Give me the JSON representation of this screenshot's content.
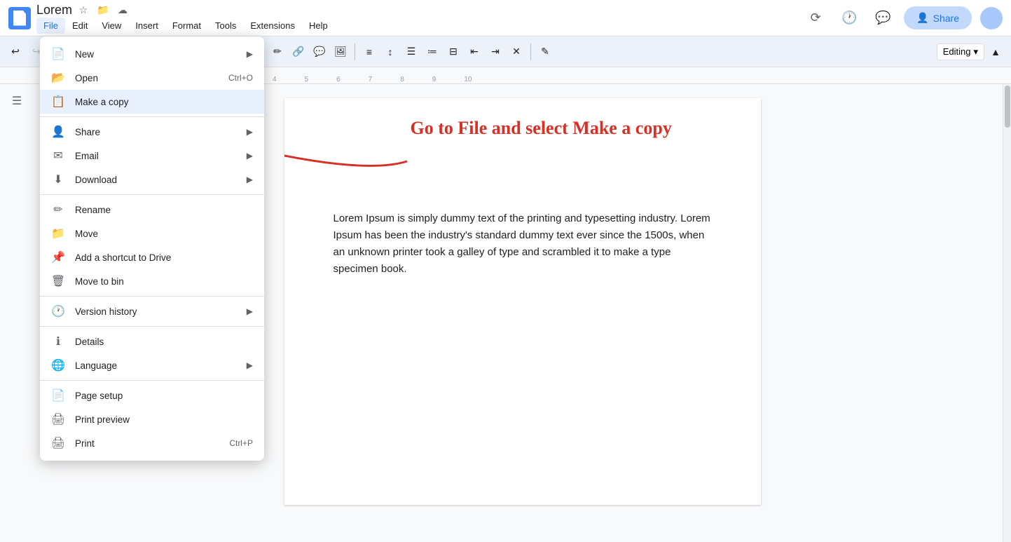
{
  "app": {
    "title": "Lorem",
    "icon_color": "#4285f4"
  },
  "header": {
    "doc_title": "Lorem",
    "share_label": "Share",
    "menu_items": [
      "File",
      "Edit",
      "View",
      "Insert",
      "Format",
      "Tools",
      "Extensions",
      "Help"
    ]
  },
  "toolbar": {
    "font": "Arial",
    "font_size": "14",
    "editing_label": "Editing"
  },
  "file_menu": {
    "items": [
      {
        "id": "new",
        "label": "New",
        "icon": "📄",
        "shortcut": "",
        "has_arrow": true,
        "section": 1
      },
      {
        "id": "open",
        "label": "Open",
        "icon": "📂",
        "shortcut": "Ctrl+O",
        "has_arrow": false,
        "section": 1
      },
      {
        "id": "make-copy",
        "label": "Make a copy",
        "icon": "📋",
        "shortcut": "",
        "has_arrow": false,
        "section": 1,
        "highlighted": true
      },
      {
        "id": "share",
        "label": "Share",
        "icon": "👤",
        "shortcut": "",
        "has_arrow": true,
        "section": 2
      },
      {
        "id": "email",
        "label": "Email",
        "icon": "✉️",
        "shortcut": "",
        "has_arrow": true,
        "section": 2
      },
      {
        "id": "download",
        "label": "Download",
        "icon": "⬇️",
        "shortcut": "",
        "has_arrow": true,
        "section": 2
      },
      {
        "id": "rename",
        "label": "Rename",
        "icon": "✏️",
        "shortcut": "",
        "has_arrow": false,
        "section": 3
      },
      {
        "id": "move",
        "label": "Move",
        "icon": "📁",
        "shortcut": "",
        "has_arrow": false,
        "section": 3
      },
      {
        "id": "add-shortcut",
        "label": "Add a shortcut to Drive",
        "icon": "📌",
        "shortcut": "",
        "has_arrow": false,
        "section": 3
      },
      {
        "id": "move-to-bin",
        "label": "Move to bin",
        "icon": "🗑️",
        "shortcut": "",
        "has_arrow": false,
        "section": 3
      },
      {
        "id": "version-history",
        "label": "Version history",
        "icon": "🕐",
        "shortcut": "",
        "has_arrow": true,
        "section": 4
      },
      {
        "id": "details",
        "label": "Details",
        "icon": "ℹ️",
        "shortcut": "",
        "has_arrow": false,
        "section": 5
      },
      {
        "id": "language",
        "label": "Language",
        "icon": "🌐",
        "shortcut": "",
        "has_arrow": true,
        "section": 5
      },
      {
        "id": "page-setup",
        "label": "Page setup",
        "icon": "📄",
        "shortcut": "",
        "has_arrow": false,
        "section": 6
      },
      {
        "id": "print-preview",
        "label": "Print preview",
        "icon": "🖨️",
        "shortcut": "",
        "has_arrow": false,
        "section": 6
      },
      {
        "id": "print",
        "label": "Print",
        "icon": "🖨️",
        "shortcut": "Ctrl+P",
        "has_arrow": false,
        "section": 6
      }
    ]
  },
  "document": {
    "text": "Lorem Ipsum is simply dummy text of the printing and typesetting industry. Lorem Ipsum has been the industry's standard dummy text ever since the 1500s, when an unknown printer took a galley of type and scrambled it to make a type specimen book.",
    "annotation": "Go to File and select Make a copy"
  }
}
